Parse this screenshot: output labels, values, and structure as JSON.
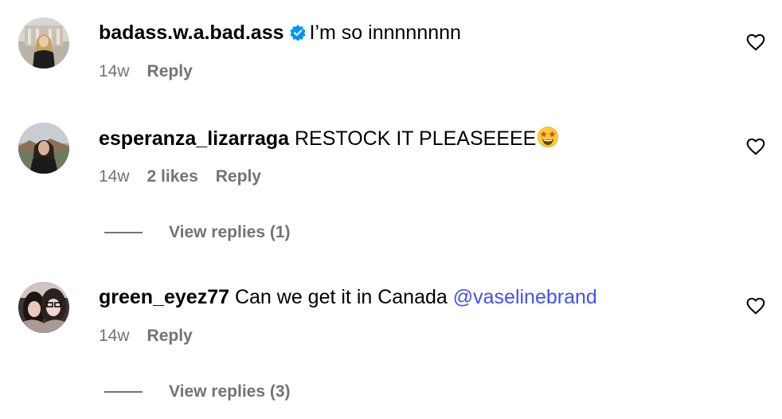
{
  "colors": {
    "text": "#000000",
    "secondary": "#737373",
    "mention": "#4150f7",
    "verified": "#0095f6"
  },
  "comments": [
    {
      "username": "badass.w.a.bad.ass",
      "verified": true,
      "text": "I’m so innnnnnnn",
      "time": "14w",
      "reply": "Reply",
      "icons": [
        "avatar",
        "verified-badge-icon",
        "heart-icon"
      ]
    },
    {
      "username": "esperanza_lizarraga",
      "verified": false,
      "text": "RESTOCK IT PLEASEEEE",
      "emoji": "star-struck-emoji",
      "time": "14w",
      "likes": "2 likes",
      "reply": "Reply",
      "view_replies": "View replies (1)"
    },
    {
      "username": "green_eyez77",
      "verified": false,
      "text": "Can we get it in Canada",
      "mention": "@vaselinebrand",
      "time": "14w",
      "reply": "Reply",
      "view_replies": "View replies (3)"
    }
  ]
}
